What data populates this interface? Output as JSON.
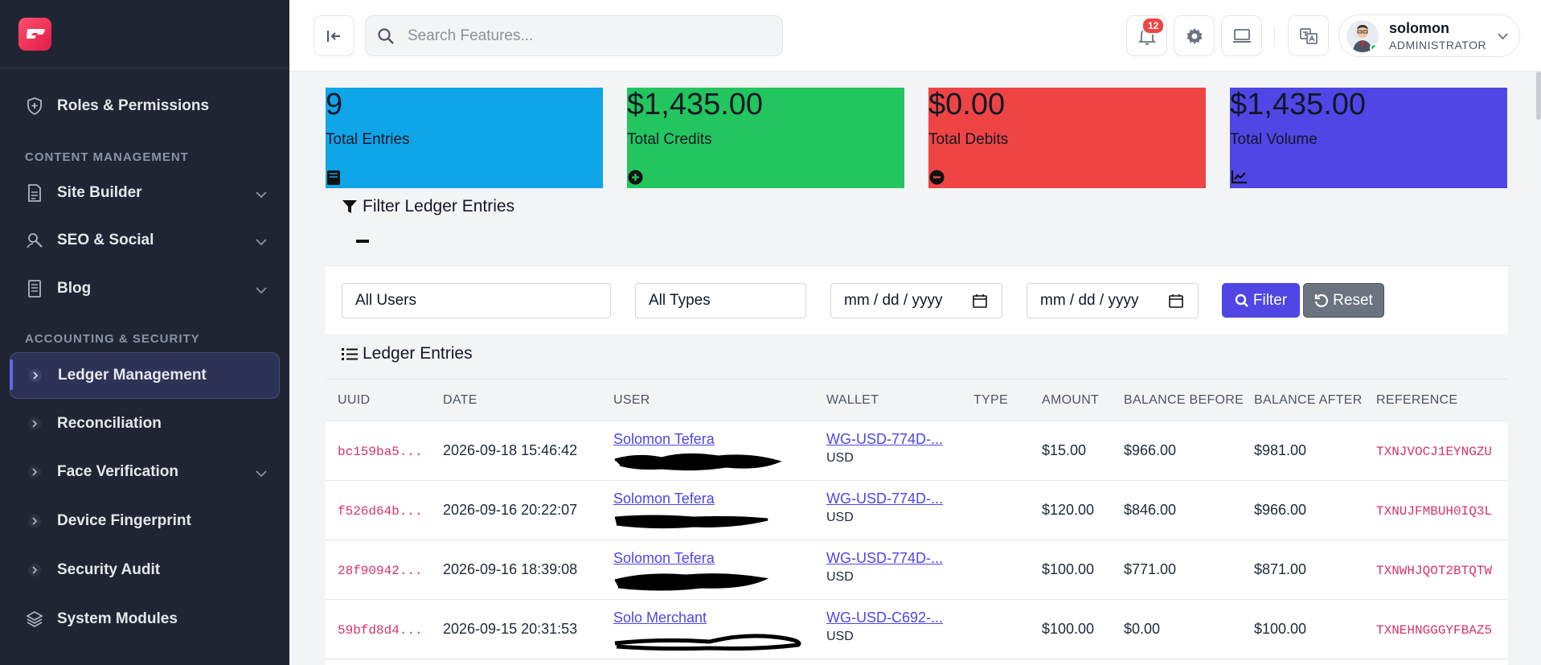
{
  "sidebar": {
    "items": [
      {
        "label": "Roles & Permissions"
      },
      {
        "label": "Site Builder"
      },
      {
        "label": "SEO & Social"
      },
      {
        "label": "Blog"
      },
      {
        "label": "Ledger Management"
      },
      {
        "label": "Reconciliation"
      },
      {
        "label": "Face Verification"
      },
      {
        "label": "Device Fingerprint"
      },
      {
        "label": "Security Audit"
      },
      {
        "label": "System Modules"
      }
    ],
    "sections": {
      "content": "CONTENT MANAGEMENT",
      "accounting": "ACCOUNTING & SECURITY"
    },
    "active": "Ledger Management"
  },
  "topbar": {
    "search_placeholder": "Search Features...",
    "notification_count": "12",
    "user": {
      "name": "solomon",
      "role": "ADMINISTRATOR"
    }
  },
  "stats": [
    {
      "value": "9",
      "label": "Total Entries",
      "color": "#0ea5e9",
      "icon": "book-icon"
    },
    {
      "value": "$1,435.00",
      "label": "Total Credits",
      "color": "#22c55e",
      "icon": "plus-circle-icon"
    },
    {
      "value": "$0.00",
      "label": "Total Debits",
      "color": "#ef4444",
      "icon": "minus-circle-icon"
    },
    {
      "value": "$1,435.00",
      "label": "Total Volume",
      "color": "#4f46e5",
      "icon": "chart-line-icon"
    }
  ],
  "filter": {
    "title": "Filter Ledger Entries",
    "user_select": "All Users",
    "type_select": "All Types",
    "date_from_placeholder": "mm / dd / yyyy",
    "date_to_placeholder": "mm / dd / yyyy",
    "filter_label": "Filter",
    "reset_label": "Reset"
  },
  "ledger": {
    "title": "Ledger Entries",
    "columns": [
      "UUID",
      "DATE",
      "USER",
      "WALLET",
      "TYPE",
      "AMOUNT",
      "BALANCE BEFORE",
      "BALANCE AFTER",
      "REFERENCE"
    ],
    "rows": [
      {
        "uuid": "bc159ba5...",
        "date": "2026-09-18 15:46:42",
        "user": "Solomon Tefera",
        "wallet": "WG-USD-774D-...",
        "currency": "USD",
        "amount": "$15.00",
        "before": "$966.00",
        "after": "$981.00",
        "ref": "TXNJVOCJ1EYNGZU"
      },
      {
        "uuid": "f526d64b...",
        "date": "2026-09-16 20:22:07",
        "user": "Solomon Tefera",
        "wallet": "WG-USD-774D-...",
        "currency": "USD",
        "amount": "$120.00",
        "before": "$846.00",
        "after": "$966.00",
        "ref": "TXNUJFMBUH0IQ3L"
      },
      {
        "uuid": "28f90942...",
        "date": "2026-09-16 18:39:08",
        "user": "Solomon Tefera",
        "wallet": "WG-USD-774D-...",
        "currency": "USD",
        "amount": "$100.00",
        "before": "$771.00",
        "after": "$871.00",
        "ref": "TXNWHJQOT2BTQTW"
      },
      {
        "uuid": "59bfd8d4...",
        "date": "2026-09-15 20:31:53",
        "user": "Solo Merchant",
        "wallet": "WG-USD-C692-...",
        "currency": "USD",
        "amount": "$100.00",
        "before": "$0.00",
        "after": "$100.00",
        "ref": "TXNEHNGGGYFBAZ5"
      }
    ]
  }
}
